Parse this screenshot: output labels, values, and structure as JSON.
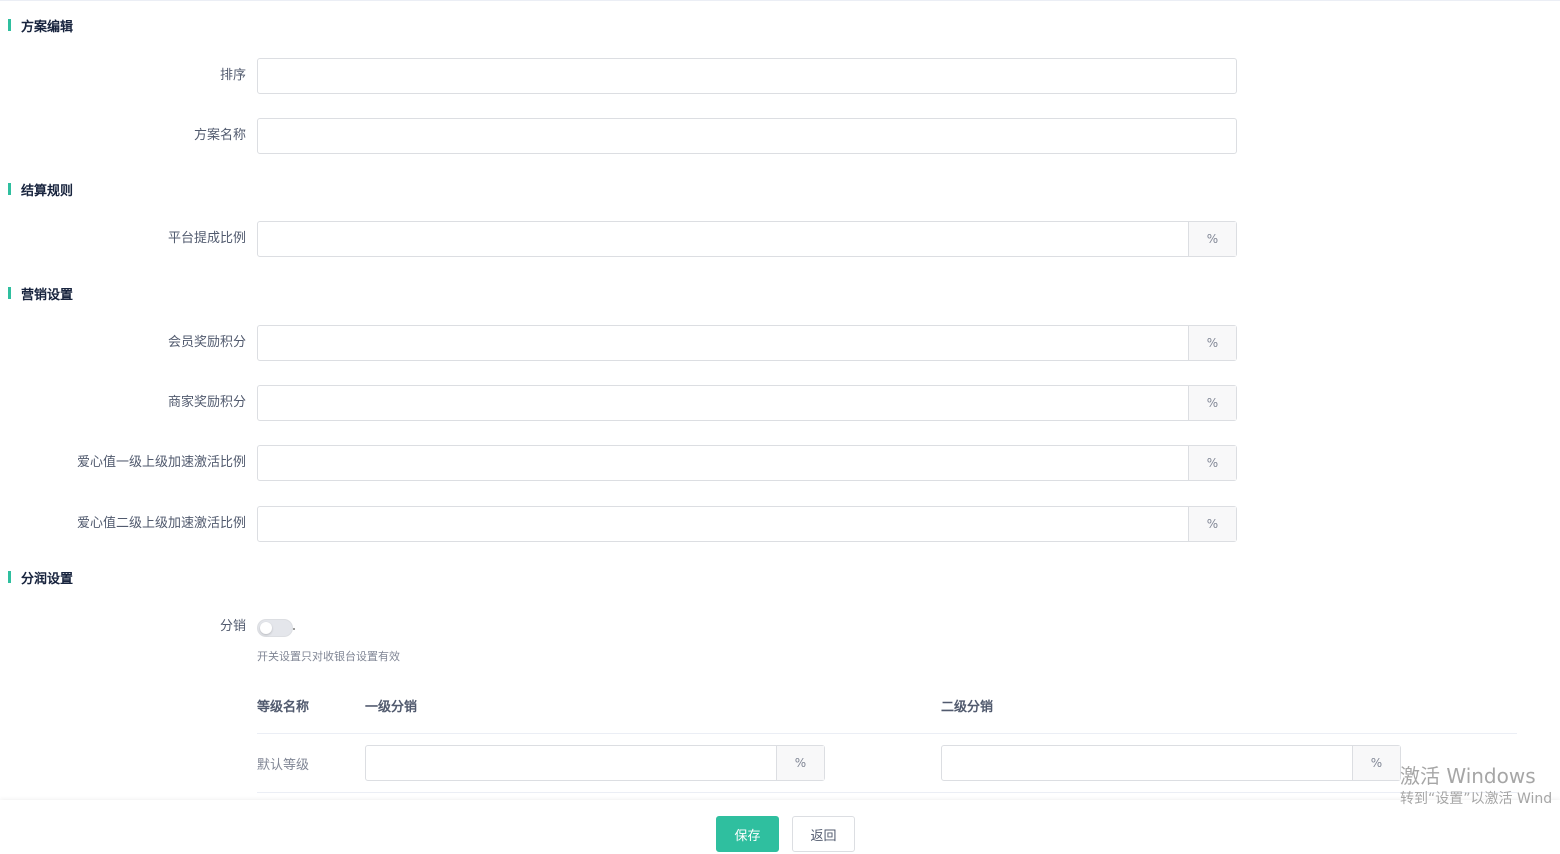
{
  "sections": {
    "plan_edit": "方案编辑",
    "settlement": "结算规则",
    "marketing": "营销设置",
    "profit_share": "分润设置"
  },
  "fields": {
    "sort": {
      "label": "排序",
      "value": ""
    },
    "plan_name": {
      "label": "方案名称",
      "value": ""
    },
    "platform_ratio": {
      "label": "平台提成比例",
      "value": "",
      "suffix": "%"
    },
    "member_points": {
      "label": "会员奖励积分",
      "value": "",
      "suffix": "%"
    },
    "merchant_points": {
      "label": "商家奖励积分",
      "value": "",
      "suffix": "%"
    },
    "love_level1": {
      "label": "爱心值一级上级加速激活比例",
      "value": "",
      "suffix": "%"
    },
    "love_level2": {
      "label": "爱心值二级上级加速激活比例",
      "value": "",
      "suffix": "%"
    }
  },
  "distribution": {
    "label": "分销",
    "enabled": false,
    "helper": "开关设置只对收银台设置有效"
  },
  "table": {
    "headers": [
      "等级名称",
      "一级分销",
      "二级分销"
    ],
    "rows": [
      {
        "level": "默认等级",
        "level1": "",
        "level2": "",
        "suffix": "%"
      }
    ]
  },
  "buttons": {
    "save": "保存",
    "back": "返回"
  },
  "watermark": {
    "line1": "激活 Windows",
    "line2": "转到“设置”以激活 Wind"
  },
  "colors": {
    "accent": "#2fbf9f"
  }
}
